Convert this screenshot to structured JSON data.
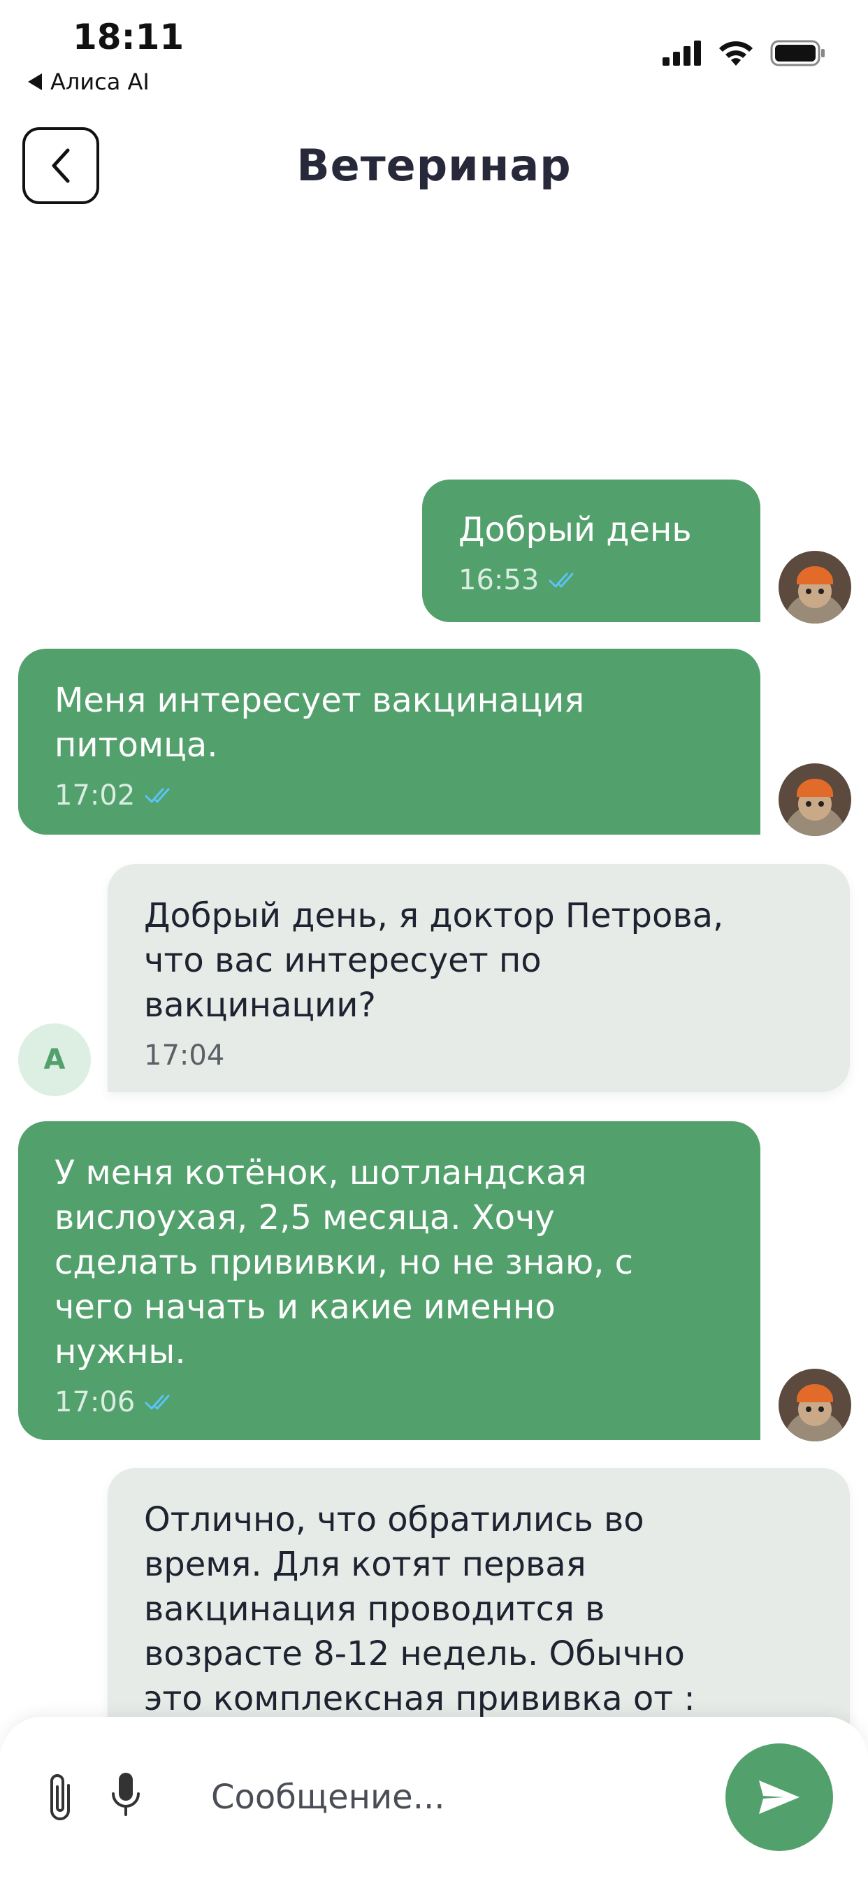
{
  "status_bar": {
    "time": "18:11",
    "back_app": "Алиса AI"
  },
  "header": {
    "title": "Ветеринар"
  },
  "messages": [
    {
      "dir": "out",
      "text": "Добрый день",
      "time": "16:53"
    },
    {
      "dir": "out",
      "text": "Меня интересует вакцинация\nпитомца.",
      "time": "17:02"
    },
    {
      "dir": "in",
      "avatar": "A",
      "text": "Добрый день, я доктор Петрова,\nчто вас интересует по\nвакцинации?",
      "time": "17:04"
    },
    {
      "dir": "out",
      "text": "У меня котёнок, шотландская\nвислоухая, 2,5 месяца. Хочу\nсделать прививки, но не знаю, с\nчего начать и какие именно\nнужны.",
      "time": "17:06"
    },
    {
      "dir": "in",
      "text": "Отлично, что обратились во\nвремя. Для котят первая\nвакцинация проводится в\nвозрасте 8-12 недель. Обычно\nэто комплексная прививка от :"
    }
  ],
  "composer": {
    "placeholder": "Сообщение..."
  },
  "icons": {
    "back": "chevron-left-icon",
    "attach": "paperclip-icon",
    "mic": "microphone-icon",
    "send": "send-icon",
    "read": "double-check-icon"
  },
  "colors": {
    "accent": "#52a06c",
    "incoming_bg": "#e6ebe7",
    "read_check": "#5cc3f5"
  }
}
